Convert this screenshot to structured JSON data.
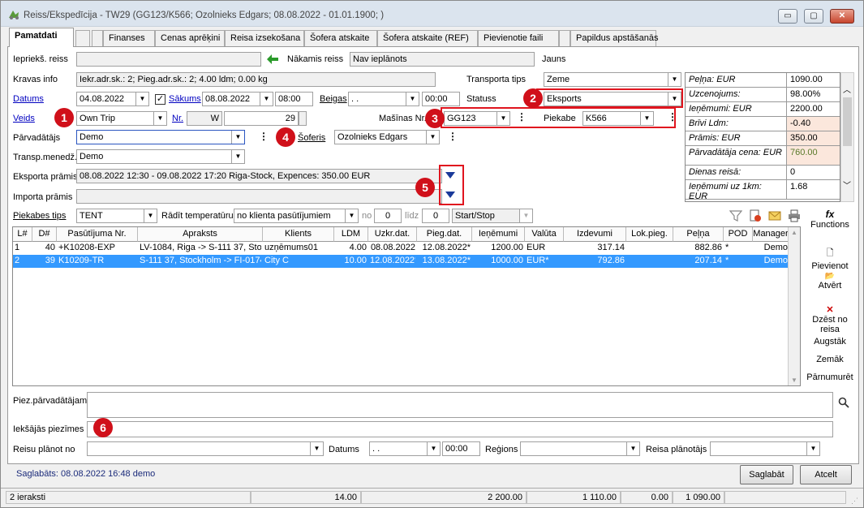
{
  "window": {
    "title": "Reiss/Ekspedīcija  - TW29  (GG123/K566; Ozolnieks Edgars; 08.08.2022 - 01.01.1900; )",
    "min": "▭",
    "max": "▢",
    "close": "✕"
  },
  "tabs": [
    {
      "label": "Pamatdati"
    },
    {
      "label": ""
    },
    {
      "label": "Finanses"
    },
    {
      "label": "Cenas aprēķini"
    },
    {
      "label": "Reisa izsekošana"
    },
    {
      "label": "Šofera atskaite"
    },
    {
      "label": "Šofera atskaite (REF)"
    },
    {
      "label": "Pievienotie faili"
    },
    {
      "label": ""
    },
    {
      "label": "Papildus apstāšanās"
    }
  ],
  "form": {
    "prev_trip_label": "Iepriekš. reiss",
    "prev_trip_value": "",
    "next_trip_label": "Nākamis reiss",
    "next_trip_value": "Nav ieplānots",
    "new_label": "Jauns",
    "cargo_label": "Kravas info",
    "cargo_value": "Iekr.adr.sk.: 2; Pieg.adr.sk.: 2; 4.00 ldm; 0.00 kg",
    "transport_type_label": "Transporta tips",
    "transport_type_value": "Zeme",
    "dates_label": "Datums",
    "date_value": "04.08.2022",
    "start_label": "Sākums",
    "start_date": "08.08.2022",
    "start_time": "08:00",
    "end_label": "Beigas",
    "end_date": ". .",
    "end_time": "00:00",
    "status_label": "Statuss",
    "status_value": "Eksports",
    "type_label": "Veids",
    "type_value": "Own Trip",
    "nr_label": "Nr.",
    "nr_prefix": "W",
    "nr_value": "29",
    "vehicle_label": "Mašīnas Nr.",
    "vehicle_value": "GG123",
    "trailer_label": "Piekabe",
    "trailer_value": "K566",
    "carrier_label": "Pārvadātājs",
    "carrier_value": "Demo",
    "driver_label": "Šoferis",
    "driver_value": "Ozolnieks Edgars",
    "manager_label": "Transp.menedž.",
    "manager_value": "Demo",
    "export_label": "Eksporta prāmis",
    "export_value": "08.08.2022 12:30 - 09.08.2022 17:20 Riga-Stock, Expences: 350.00 EUR",
    "import_label": "Importa prāmis",
    "import_value": "",
    "trailer_type_label": "Piekabes tips",
    "trailer_type_value": "TENT",
    "show_temp_label": "Rādīt temperatūru",
    "show_temp_value": "no klienta pasūtījumiem",
    "from_label": "no",
    "from_value": "0",
    "to_label": "līdz",
    "to_value": "0",
    "startstop_value": "Start/Stop"
  },
  "stats": [
    {
      "k": "Peļņa: EUR",
      "v": "1090.00",
      "bg": "#ffffff"
    },
    {
      "k": "Uzcenojums:",
      "v": "98.00%",
      "bg": "#ffffff"
    },
    {
      "k": "Ieņēmumi: EUR",
      "v": "2200.00",
      "bg": "#ffffff"
    },
    {
      "k": "Brīvi Ldm:",
      "v": "-0.40",
      "bg": "#fbe7dc"
    },
    {
      "k": "Prāmis: EUR",
      "v": "350.00",
      "bg": "#fbe7dc"
    },
    {
      "k": "Pārvadātāja cena: EUR",
      "v": "760.00",
      "bg": "#fbe7dc",
      "vc": "#5a7a2a"
    },
    {
      "k": "Dienas reisā:",
      "v": "0",
      "bg": "#ffffff"
    },
    {
      "k": "Ieņēmumi uz 1km: EUR",
      "v": "1.68",
      "bg": "#ffffff"
    }
  ],
  "grid": {
    "headers": [
      "L#",
      "D#",
      "Pasūtījuma Nr.",
      "Apraksts",
      "Klients",
      "LDM",
      "Uzkr.dat.",
      "Pieg.dat.",
      "Ieņēmumi",
      "Valūta",
      "Izdevumi",
      "Lok.pieg.",
      "Peļņa",
      "POD",
      "Manager"
    ],
    "rows": [
      [
        "1",
        "40",
        "+K10208-EXP",
        "LV-1084, Riga -> S-111 37, Stoc",
        "uzņēmums01",
        "4.00",
        "08.08.2022",
        "12.08.2022*",
        "1200.00",
        "EUR",
        "317.14",
        "",
        "882.86",
        "*",
        "Demo"
      ],
      [
        "2",
        "39",
        "K10209-TR",
        "S-111 37, Stockholm -> FI-0174C",
        "City C",
        "10.00",
        "12.08.2022*",
        "13.08.2022*",
        "1000.00",
        "EUR*",
        "792.86",
        "",
        "207.14",
        "*",
        "Demo"
      ]
    ]
  },
  "side_buttons": {
    "functions": "Functions",
    "add": "Pievienot",
    "open": "Atvērt",
    "delete": "Dzēst no reisa",
    "up": "Augstāk",
    "down": "Zemāk",
    "rename": "Pārnumurēt"
  },
  "notes": {
    "carrier_notes_label": "Piez.pārvadātājam",
    "internal_notes_label": "Iekšājās piezīmes",
    "plan_from_label": "Reisu plānot no",
    "date_label": "Datums",
    "date_value": ". .",
    "time_value": "00:00",
    "region_label": "Reģions",
    "planner_label": "Reisa plānotājs"
  },
  "status": {
    "saved": "Saglabāts: 08.08.2022 16:48 demo",
    "save_btn": "Saglabāt",
    "cancel_btn": "Atcelt"
  },
  "statusbar": {
    "count": "2 ieraksti",
    "ldm": "14.00",
    "income": "2 200.00",
    "expenses": "1 110.00",
    "zero": "0.00",
    "profit": "1 090.00"
  },
  "markers": [
    "1",
    "2",
    "3",
    "4",
    "5",
    "6"
  ]
}
